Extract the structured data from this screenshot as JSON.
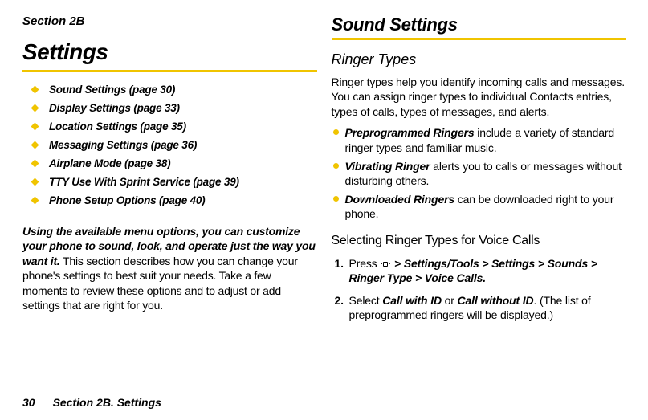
{
  "left": {
    "section_label": "Section 2B",
    "title": "Settings",
    "toc": [
      "Sound Settings (page 30)",
      "Display Settings (page 33)",
      "Location Settings (page 35)",
      "Messaging Settings (page 36)",
      "Airplane Mode (page 38)",
      "TTY Use With Sprint Service (page 39)",
      "Phone Setup Options (page 40)"
    ],
    "intro_lead": "Using the available menu options, you can customize your phone to sound, look, and operate just the way you want it.",
    "intro_rest": " This section describes how you can change your phone's settings to best suit your needs. Take a few moments to review these options and to adjust or add settings that are right for you."
  },
  "right": {
    "heading": "Sound Settings",
    "sub1": "Ringer Types",
    "para1": "Ringer types help you identify incoming calls and messages. You can assign ringer types to individual Contacts entries, types of calls, types of messages, and alerts.",
    "bullets": [
      {
        "bold": "Preprogrammed Ringers",
        "rest": " include a variety of standard ringer types and familiar music."
      },
      {
        "bold": "Vibrating Ringer",
        "rest": " alerts you to calls or messages without disturbing others."
      },
      {
        "bold": "Downloaded Ringers",
        "rest": " can be downloaded right to your phone."
      }
    ],
    "sub2": "Selecting Ringer Types for Voice Calls",
    "step1_prefix": "Press ",
    "step1_path": " > Settings/Tools > Settings > Sounds > Ringer Type > Voice Calls.",
    "step2_prefix": "Select ",
    "step2_opt1": "Call with ID",
    "step2_or": " or ",
    "step2_opt2": "Call without ID",
    "step2_rest": ". (The list of preprogrammed ringers will be displayed.)"
  },
  "footer": {
    "page": "30",
    "section": "Section 2B. Settings"
  }
}
